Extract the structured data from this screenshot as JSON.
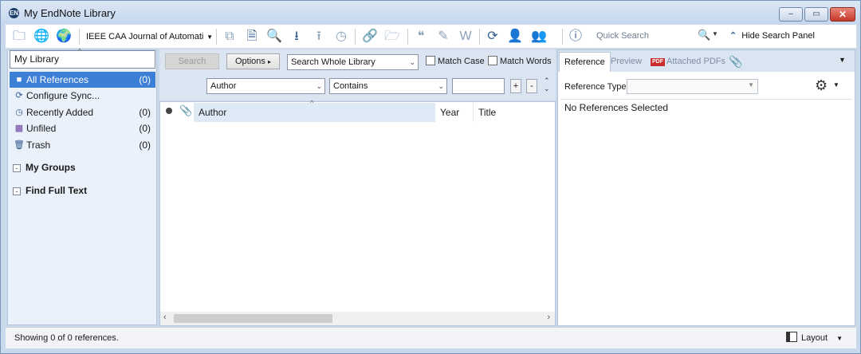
{
  "window": {
    "title": "My EndNote Library",
    "minimize": "–",
    "maximize": "▭",
    "close": "✕"
  },
  "toolbar": {
    "style_value": "IEEE CAA Journal of Automati",
    "quick_search_placeholder": "Quick Search",
    "hide_search_panel": "Hide Search Panel"
  },
  "sidebar": {
    "library_label": "My Library",
    "items": [
      {
        "label": "All References",
        "count": "(0)"
      },
      {
        "label": "Configure Sync...",
        "count": ""
      },
      {
        "label": "Recently Added",
        "count": "(0)"
      },
      {
        "label": "Unfiled",
        "count": "(0)"
      },
      {
        "label": "Trash",
        "count": "(0)"
      }
    ],
    "my_groups": "My Groups",
    "find_full_text": "Find Full Text"
  },
  "search": {
    "search_button": "Search",
    "options_button": "Options",
    "scope": "Search Whole Library",
    "match_case": "Match Case",
    "match_words": "Match Words",
    "field": "Author",
    "operator": "Contains",
    "value": "",
    "plus": "+",
    "minus": "-"
  },
  "table": {
    "columns": [
      "Author",
      "Year",
      "Title"
    ]
  },
  "details": {
    "tabs": [
      "Reference",
      "Preview",
      "Attached PDFs"
    ],
    "pdf_badge": "PDF",
    "reference_type_label": "Reference Type:",
    "no_selection": "No References Selected"
  },
  "status": {
    "text": "Showing 0 of 0 references.",
    "layout": "Layout"
  },
  "colors": {
    "accent": "#3d7fd6",
    "pane_bg": "#eaf1fb",
    "frame": "#c9d9ec"
  }
}
